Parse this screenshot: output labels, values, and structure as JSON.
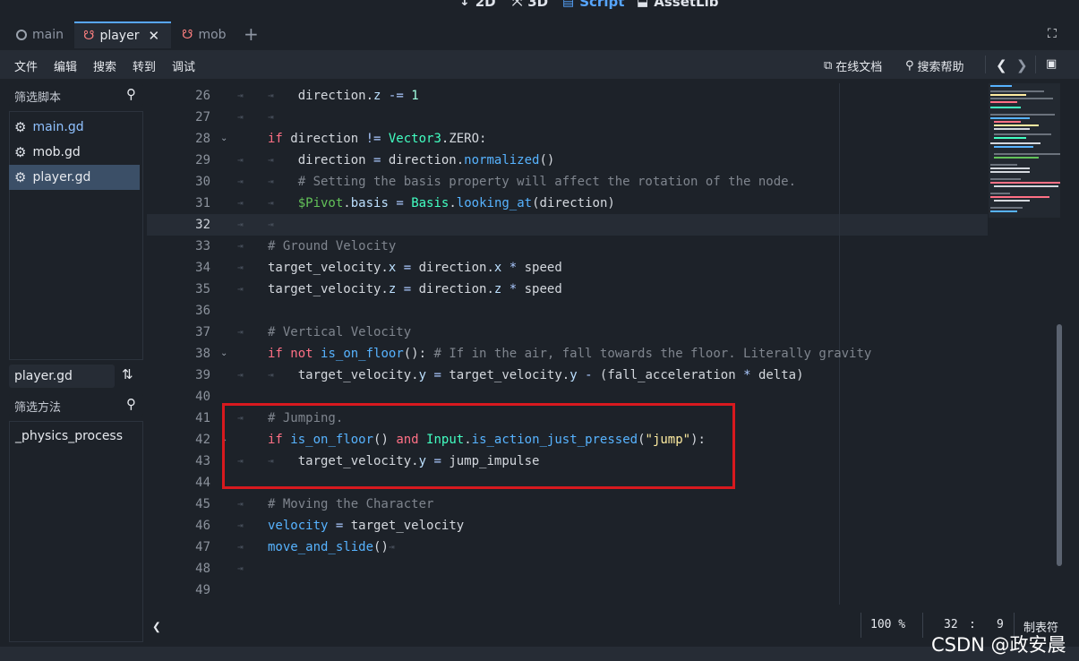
{
  "workspaces": [
    {
      "icon": "↕",
      "label": "2D"
    },
    {
      "icon": "⤧",
      "label": "3D"
    },
    {
      "icon": "▤",
      "label": "Script"
    },
    {
      "icon": "⬓",
      "label": "AssetLib"
    }
  ],
  "scene_tabs": [
    {
      "label": "main"
    },
    {
      "label": "player"
    },
    {
      "label": "mob"
    }
  ],
  "menu": {
    "items": [
      "文件",
      "编辑",
      "搜索",
      "转到",
      "调试"
    ],
    "online_docs": "在线文档",
    "search_help": "搜索帮助"
  },
  "script_panel": {
    "filter_placeholder": "筛选脚本",
    "scripts": [
      "main.gd",
      "mob.gd",
      "player.gd"
    ],
    "current_script": "player.gd",
    "method_filter_placeholder": "筛选方法",
    "methods": [
      "_physics_process"
    ]
  },
  "editor": {
    "line_numbers": [
      "26",
      "27",
      "28",
      "29",
      "30",
      "31",
      "32",
      "33",
      "34",
      "35",
      "36",
      "37",
      "38",
      "39",
      "40",
      "41",
      "42",
      "43",
      "44",
      "45",
      "46",
      "47",
      "48",
      "49"
    ],
    "current_line": 32
  },
  "status": {
    "zoom": "100 %",
    "line": "32",
    "col": "9",
    "indent_mode": "制表符"
  },
  "colors": {
    "accent": "#57a6ff",
    "highlight_box": "#d8191e"
  },
  "watermark": "CSDN @政安晨"
}
